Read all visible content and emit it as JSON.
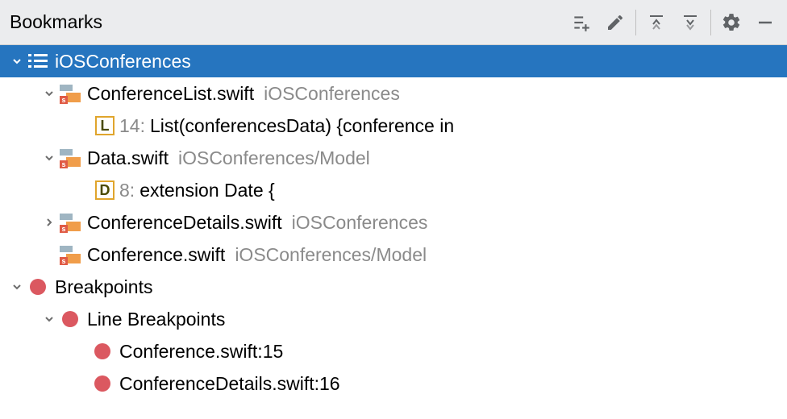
{
  "header": {
    "title": "Bookmarks"
  },
  "root": {
    "label": "iOSConferences",
    "files": [
      {
        "name": "ConferenceList.swift",
        "path": "iOSConferences",
        "bookmark": {
          "letter": "L",
          "line": "14:",
          "text": "List(conferencesData) {conference in"
        }
      },
      {
        "name": "Data.swift",
        "path": "iOSConferences/Model",
        "bookmark": {
          "letter": "D",
          "line": "8:",
          "text": "extension Date {"
        }
      },
      {
        "name": "ConferenceDetails.swift",
        "path": "iOSConferences"
      },
      {
        "name": "Conference.swift",
        "path": "iOSConferences/Model"
      }
    ]
  },
  "breakpoints": {
    "label": "Breakpoints",
    "line_group": "Line Breakpoints",
    "items": [
      "Conference.swift:15",
      "ConferenceDetails.swift:16"
    ]
  }
}
